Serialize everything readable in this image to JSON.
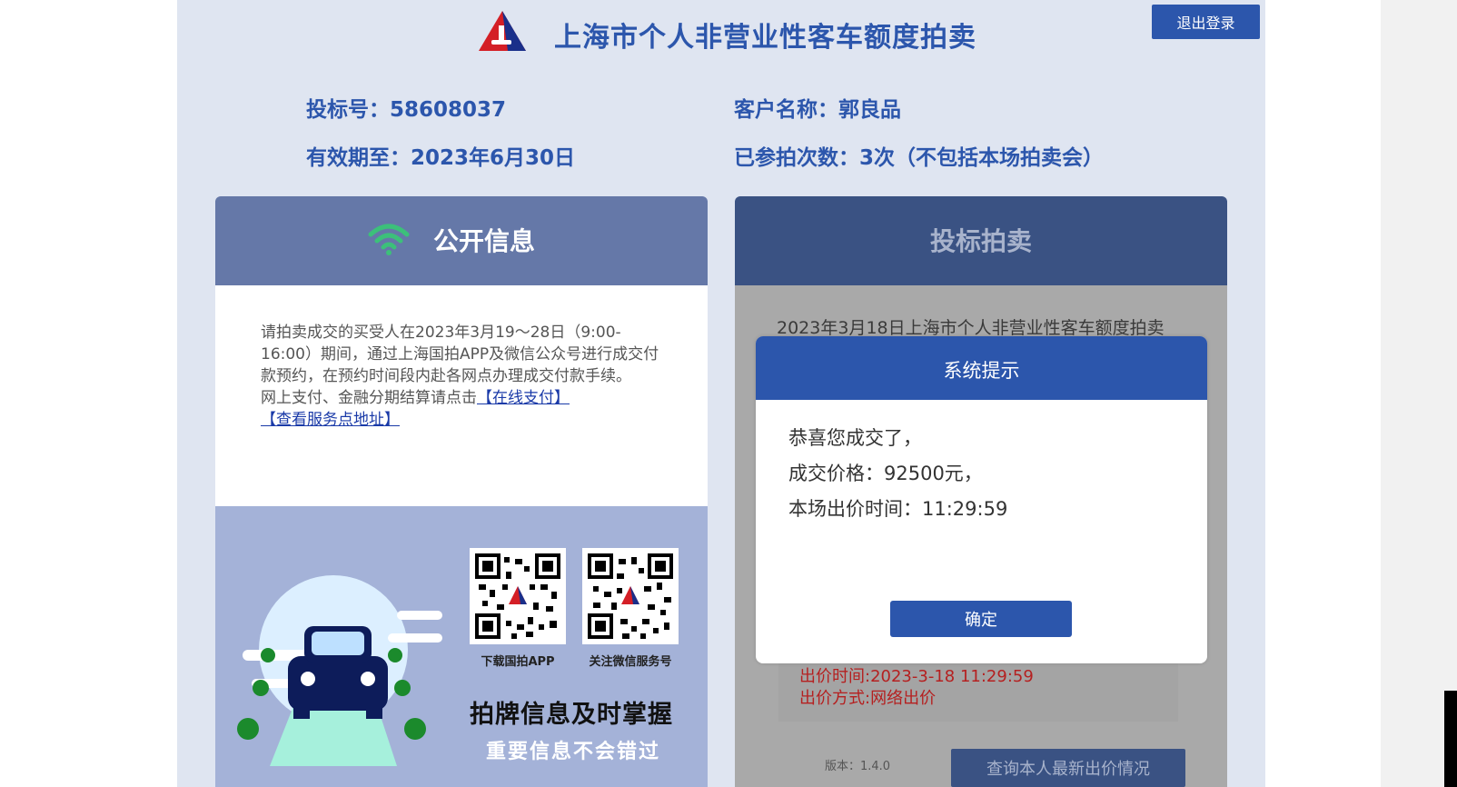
{
  "header": {
    "title": "上海市个人非营业性客车额度拍卖",
    "logout_label": "退出登录"
  },
  "user_info": {
    "bid_no_label": "投标号：",
    "bid_no": "58608037",
    "customer_label": "客户名称：",
    "customer": "郭良品",
    "valid_label": "有效期至：",
    "valid_until": "2023年6月30日",
    "count_label": "已参拍次数：",
    "count": "3次（不包括本场拍卖会）"
  },
  "public_info": {
    "title": "公开信息",
    "notice": "请拍卖成交的买受人在2023年3月19～28日（9:00-16:00）期间，通过上海国拍APP及微信公众号进行成交付款预约，在预约时间段内赴各网点办理成交付款手续。",
    "pay_prefix": "网上支付、金融分期结算请点击",
    "pay_link": "【在线支付】",
    "service_link": "【查看服务点地址】",
    "qr1_label": "下载国拍APP",
    "qr2_label": "关注微信服务号",
    "promo_line1": "拍牌信息及时掌握",
    "promo_line2": "重要信息不会错过"
  },
  "bidding": {
    "title": "投标拍卖",
    "auction_name": "2023年3月18日上海市个人非营业性客车额度拍卖",
    "bid_time": "出价时间:2023-3-18 11:29:59",
    "bid_method": "出价方式:网络出价",
    "version": "版本：1.4.0",
    "query_label": "查询本人最新出价情况"
  },
  "modal": {
    "title": "系统提示",
    "line1": "恭喜您成交了，",
    "line2": "成交价格：92500元，",
    "line3": "本场出价时间：11:29:59",
    "ok_label": "确定"
  },
  "colors": {
    "brand": "#2c56ac",
    "bg": "#dfe5f1",
    "alert_red": "#b52020"
  }
}
